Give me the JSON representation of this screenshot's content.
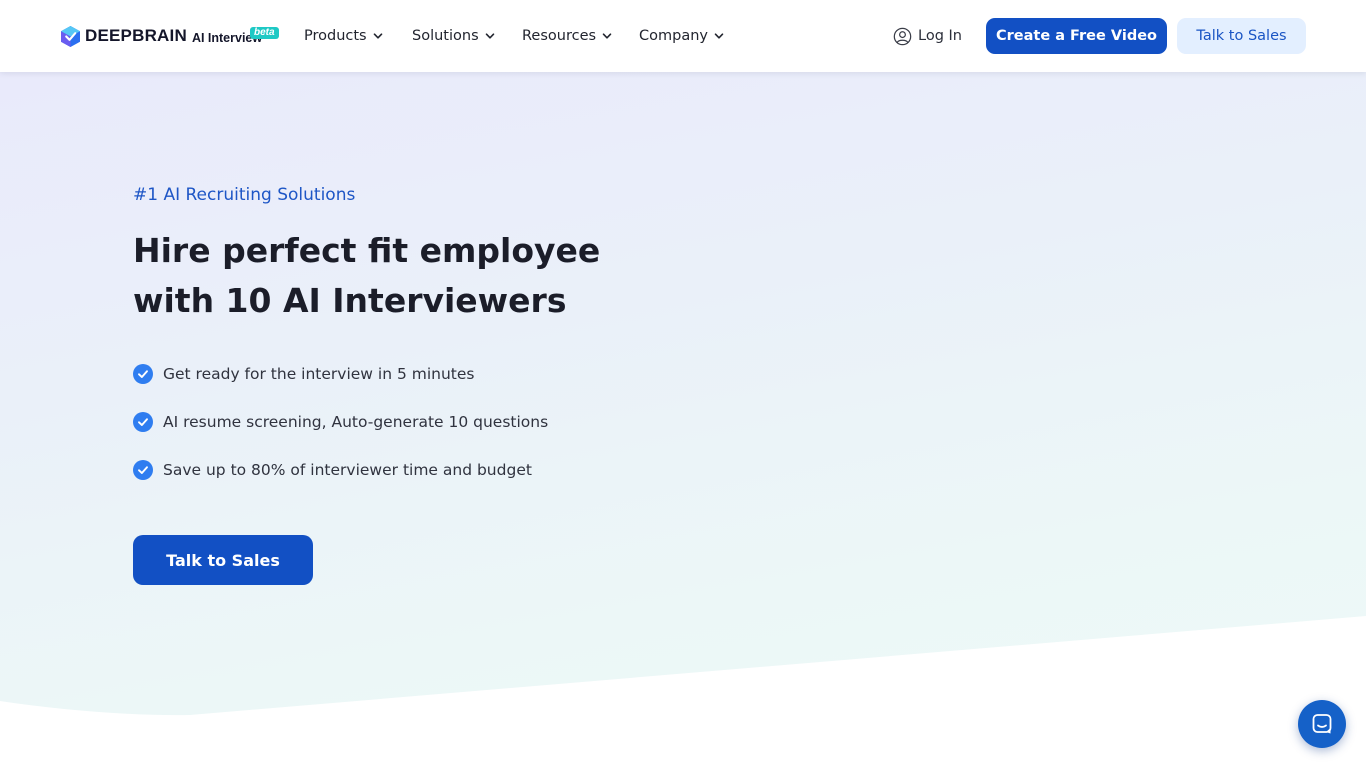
{
  "header": {
    "logo": {
      "brand": "DEEPBRAIN",
      "product": "AI Interview",
      "badge": "beta"
    },
    "nav": [
      {
        "label": "Products",
        "icon": "chevron-down-icon"
      },
      {
        "label": "Solutions",
        "icon": "chevron-down-icon"
      },
      {
        "label": "Resources",
        "icon": "chevron-down-icon"
      },
      {
        "label": "Company",
        "icon": "chevron-down-icon"
      }
    ],
    "login_label": "Log In",
    "create_label": "Create a Free Video",
    "sales_label": "Talk to Sales"
  },
  "hero": {
    "eyebrow": "#1 AI Recruiting Solutions",
    "headline_line1": "Hire perfect fit employee",
    "headline_line2": "with 10 AI Interviewers",
    "features": [
      "Get ready for the interview in 5 minutes",
      "AI resume screening, Auto-generate 10 questions",
      "Save up to 80% of interviewer time and budget"
    ],
    "cta_label": "Talk to Sales"
  },
  "colors": {
    "primary": "#1250c4",
    "accent_light": "#e3efff",
    "check": "#2f7df0",
    "beta_badge": "#1ec9c5",
    "chat": "#1561c8"
  },
  "icons": {
    "login": "user-circle-icon",
    "check": "check-circle-icon",
    "chat": "chat-bubble-icon"
  }
}
